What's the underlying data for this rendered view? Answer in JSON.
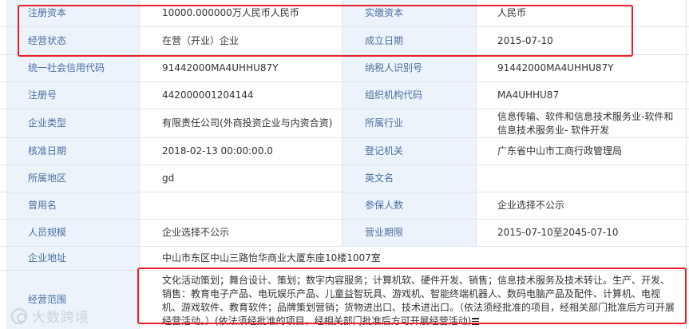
{
  "rows": [
    {
      "l1": "注册资本",
      "v1": "10000.000000万人民币人民币",
      "l2": "实缴资本",
      "v2": "人民币"
    },
    {
      "l1": "经营状态",
      "v1": "在营（开业）企业",
      "l2": "成立日期",
      "v2": "2015-07-10"
    },
    {
      "l1": "统一社会信用代码",
      "v1": "91442000MA4UHHU87Y",
      "l2": "纳税人识别号",
      "v2": "91442000MA4UHHU87Y"
    },
    {
      "l1": "注册号",
      "v1": "442000001204144",
      "l2": "组织机构代码",
      "v2": "MA4UHHU87"
    },
    {
      "l1": "企业类型",
      "v1": "有限责任公司(外商投资企业与内资合资)",
      "l2": "所属行业",
      "v2": "信息传输、软件和信息技术服务业-软件和信息技术服务业- 软件开发"
    },
    {
      "l1": "核准日期",
      "v1": "2018-02-13 00:00:00.0",
      "l2": "登记机关",
      "v2": "广东省中山市工商行政管理局"
    },
    {
      "l1": "所属地区",
      "v1": "gd",
      "l2": "英文名",
      "v2": ""
    },
    {
      "l1": "曾用名",
      "v1": "",
      "l2": "参保人数",
      "v2": "企业选择不公示"
    },
    {
      "l1": "人员规模",
      "v1": "企业选择不公示",
      "l2": "营业期限",
      "v2": "2015-07-10至2045-07-10"
    }
  ],
  "address": {
    "label": "企业地址",
    "value": "中山市东区中山三路怡华商业大厦东座10楼1007室"
  },
  "scope": {
    "label": "经营范围",
    "value": "文化活动策划；舞台设计、策划；数字内容服务；计算机软、硬件开发、销售；信息技术服务及技术转让。生产、开发、销售：教育电子产品、电玩娱乐产品、儿童益智玩具、游戏机、智能终端机器人、数码电脑产品及配件、计算机、电视机、游戏软件、教育软件；品牌策划营销；货物进出口、技术进出口。（依法须经批准的项目，经相关部门批准后方可开展经营活动。）(依法须经批准的项目，经相关部门批准后方可开展经营活动)"
  },
  "watermark": {
    "text": "大数跨境"
  },
  "colors": {
    "label_bg": "#edf3fa",
    "label_text": "#4a6fa5",
    "highlight": "#e8202a",
    "border": "#e0e6ee"
  }
}
